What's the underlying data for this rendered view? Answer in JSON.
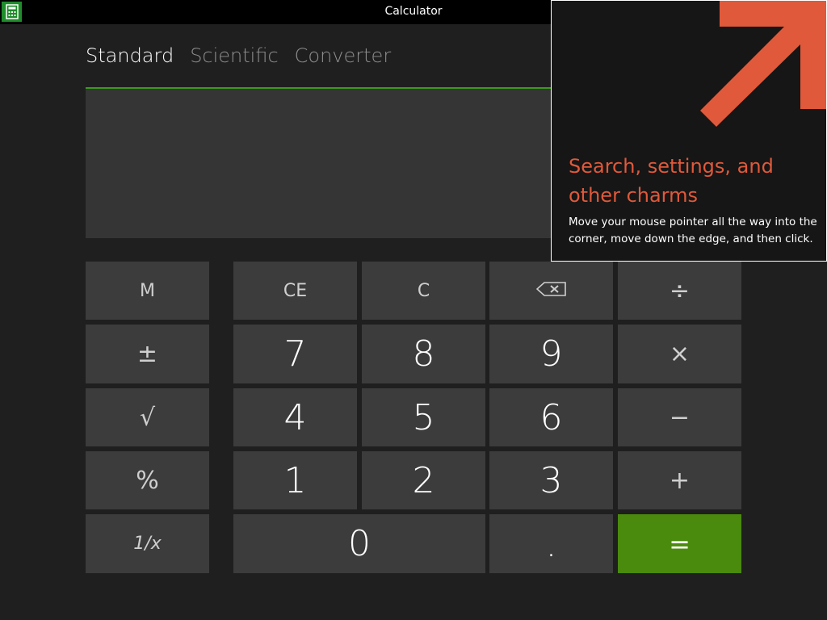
{
  "window": {
    "title": "Calculator",
    "app_icon": "calculator-icon"
  },
  "tabs": [
    {
      "label": "Standard",
      "active": true
    },
    {
      "label": "Scientific",
      "active": false
    },
    {
      "label": "Converter",
      "active": false
    }
  ],
  "display": {
    "value": ""
  },
  "keys": {
    "memory": "M",
    "plus_minus": "±",
    "sqrt": "√",
    "percent": "%",
    "reciprocal": "1/x",
    "clear_entry": "CE",
    "clear": "C",
    "backspace": "backspace-icon",
    "divide": "÷",
    "seven": "7",
    "eight": "8",
    "nine": "9",
    "multiply": "×",
    "four": "4",
    "five": "5",
    "six": "6",
    "subtract": "−",
    "one": "1",
    "two": "2",
    "three": "3",
    "add": "+",
    "zero": "0",
    "decimal": ".",
    "equals": "="
  },
  "charms_tip": {
    "title": "Search, settings, and other charms",
    "body": "Move your mouse pointer all the way into the corner, move down the edge, and then click.",
    "arrow": "arrow-up-right-icon"
  },
  "colors": {
    "accent_green": "#4a8a0d",
    "display_underline": "#3a9a1d",
    "tip_orange": "#e0593a"
  }
}
